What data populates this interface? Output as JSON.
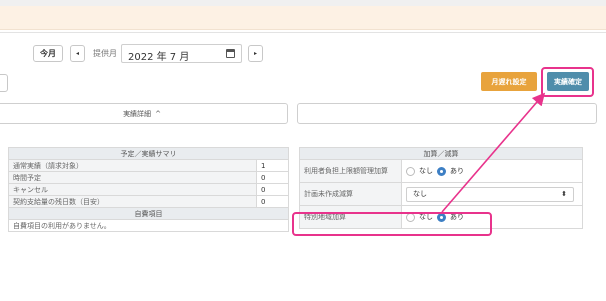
{
  "toolbar": {
    "today_label": "今月",
    "prev_glyph": "◂",
    "next_glyph": "▸",
    "month_label": "提供月",
    "month_value": "2022 年 7 月",
    "calendar_icon": "calendar-icon"
  },
  "actions": {
    "overdue_label": "月遅れ設定",
    "confirm_label": "実績確定"
  },
  "detail": {
    "toggle_label": "実績詳細",
    "toggle_icon": "chevron-up-icon",
    "toggle_glyph": "^"
  },
  "summary": {
    "header": "予定／実績サマリ",
    "rows": [
      {
        "label": "通常実績（請求対象）",
        "value": "1"
      },
      {
        "label": "時間予定",
        "value": "0"
      },
      {
        "label": "キャンセル",
        "value": "0"
      },
      {
        "label": "契約支給量の残日数（目安）",
        "value": "0"
      }
    ],
    "self_header": "自費項目",
    "self_text": "自費項目の利用がありません。"
  },
  "adjustments": {
    "header": "加算／減算",
    "rows": [
      {
        "label": "利用者負担上限額管理加算",
        "type": "radio",
        "option_none": "なし",
        "option_yes": "あり",
        "selected": "あり"
      },
      {
        "label": "計画未作成減算",
        "type": "select",
        "value": "なし",
        "select_glyph": "⬍"
      },
      {
        "label": "特別地域加算",
        "type": "radio",
        "option_none": "なし",
        "option_yes": "あり",
        "selected": "あり"
      }
    ]
  },
  "colors": {
    "highlight": "#e8338c",
    "confirm_button": "#4f8dab",
    "overdue_button": "#e8a33c",
    "notice_bar": "#fdf1e4"
  }
}
